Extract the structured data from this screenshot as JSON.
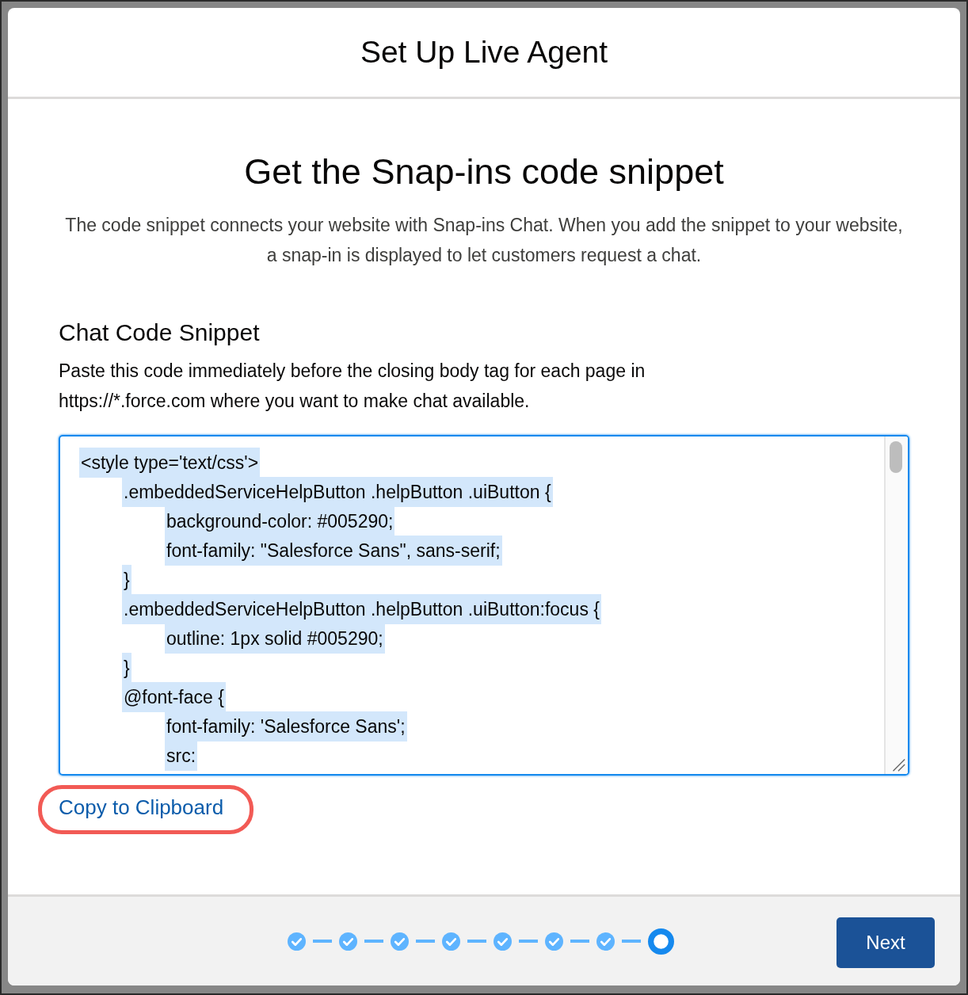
{
  "modal": {
    "title": "Set Up Live Agent"
  },
  "heading": "Get the Snap-ins code snippet",
  "description": "The code snippet connects your website with Snap-ins Chat. When you add the snippet to your website, a snap-in is displayed to let customers request a chat.",
  "section": {
    "title": "Chat Code Snippet",
    "instructions": "Paste this code immediately before the closing body tag for each page in https://*.force.com where you want to make chat available."
  },
  "code": {
    "selected": true,
    "lines": [
      {
        "text": "<style type='text/css'>",
        "children": [
          {
            "text": ".embeddedServiceHelpButton .helpButton .uiButton {",
            "children": [
              {
                "text": "background-color: #005290;"
              },
              {
                "text": "font-family: \"Salesforce Sans\", sans-serif;"
              }
            ]
          },
          {
            "text": "}"
          },
          {
            "text": ".embeddedServiceHelpButton .helpButton .uiButton:focus {",
            "children": [
              {
                "text": "outline: 1px solid #005290;"
              }
            ]
          },
          {
            "text": "}"
          },
          {
            "text": "@font-face {",
            "children": [
              {
                "text": "font-family: 'Salesforce Sans';"
              },
              {
                "text": "src:"
              }
            ]
          }
        ]
      }
    ]
  },
  "copy_link": "Copy to Clipboard",
  "steps": [
    {
      "completed": true
    },
    {
      "completed": true
    },
    {
      "completed": true
    },
    {
      "completed": true
    },
    {
      "completed": true
    },
    {
      "completed": true
    },
    {
      "completed": true
    },
    {
      "completed": false
    }
  ],
  "next_button": "Next"
}
